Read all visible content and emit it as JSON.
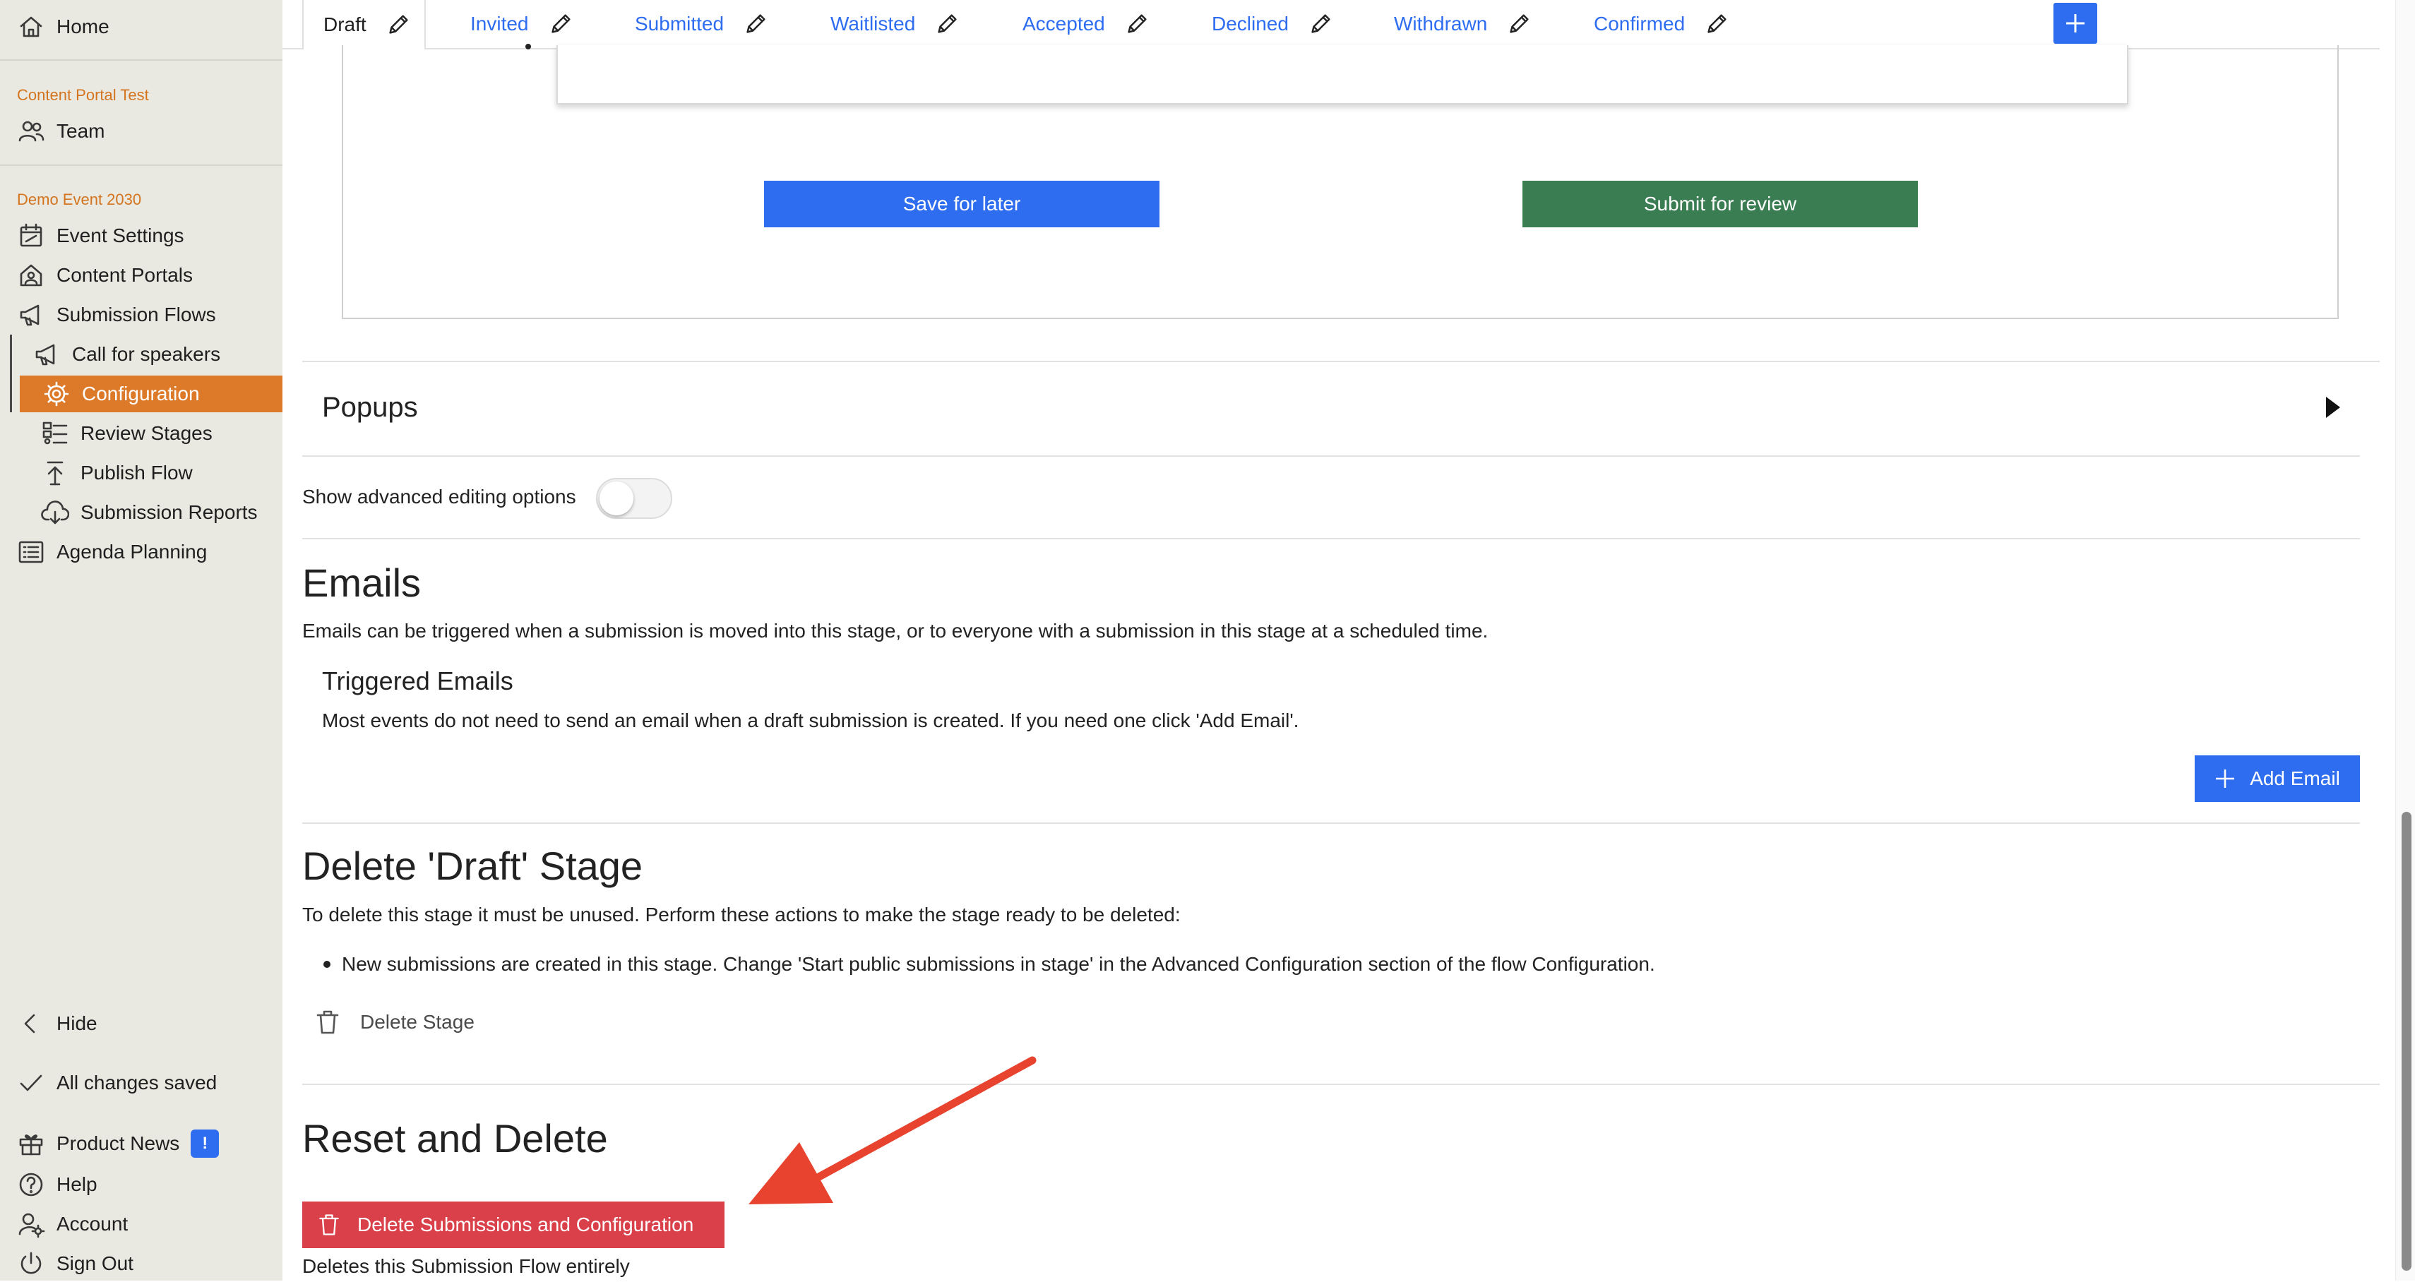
{
  "sidebar": {
    "home": "Home",
    "section_portal": "Content Portal Test",
    "team": "Team",
    "section_event": "Demo Event 2030",
    "event_settings": "Event Settings",
    "content_portals": "Content Portals",
    "submission_flows": "Submission Flows",
    "call_for_speakers": "Call for speakers",
    "configuration": "Configuration",
    "review_stages": "Review Stages",
    "publish_flow": "Publish Flow",
    "submission_reports": "Submission Reports",
    "agenda_planning": "Agenda Planning",
    "hide": "Hide",
    "saved_status": "All changes saved",
    "product_news": "Product News",
    "product_news_badge": "!",
    "help": "Help",
    "account": "Account",
    "sign_out": "Sign Out"
  },
  "tabs": [
    "Draft",
    "Invited",
    "Submitted",
    "Waitlisted",
    "Accepted",
    "Declined",
    "Withdrawn",
    "Confirmed"
  ],
  "preview": {
    "save_label": "Save for later",
    "submit_label": "Submit for review"
  },
  "popups": {
    "title": "Popups"
  },
  "advanced_toggle": {
    "label": "Show advanced editing options",
    "on": false
  },
  "emails": {
    "title": "Emails",
    "description": "Emails can be triggered when a submission is moved into this stage, or to everyone with a submission in this stage at a scheduled time.",
    "triggered_title": "Triggered Emails",
    "triggered_note": "Most events do not need to send an email when a draft submission is created. If you need one click 'Add Email'.",
    "add_label": "Add Email"
  },
  "delete_stage": {
    "title": "Delete 'Draft' Stage",
    "intro": "To delete this stage it must be unused. Perform these actions to make the stage ready to be deleted:",
    "bullet": "New submissions are created in this stage. Change 'Start public submissions in stage' in the Advanced Configuration section of the flow Configuration.",
    "button_label": "Delete Stage"
  },
  "reset": {
    "title": "Reset and Delete",
    "button_label": "Delete Submissions and Configuration",
    "note": "Deletes this Submission Flow entirely"
  },
  "colors": {
    "accent_blue": "#2f6df0",
    "submit_green": "#3a7d52",
    "danger_red": "#d9404a",
    "active_orange": "#dd7a2a",
    "section_orange": "#d4741e",
    "sidebar_bg": "#e9e9e1",
    "annotation_arrow": "#e8432e"
  }
}
